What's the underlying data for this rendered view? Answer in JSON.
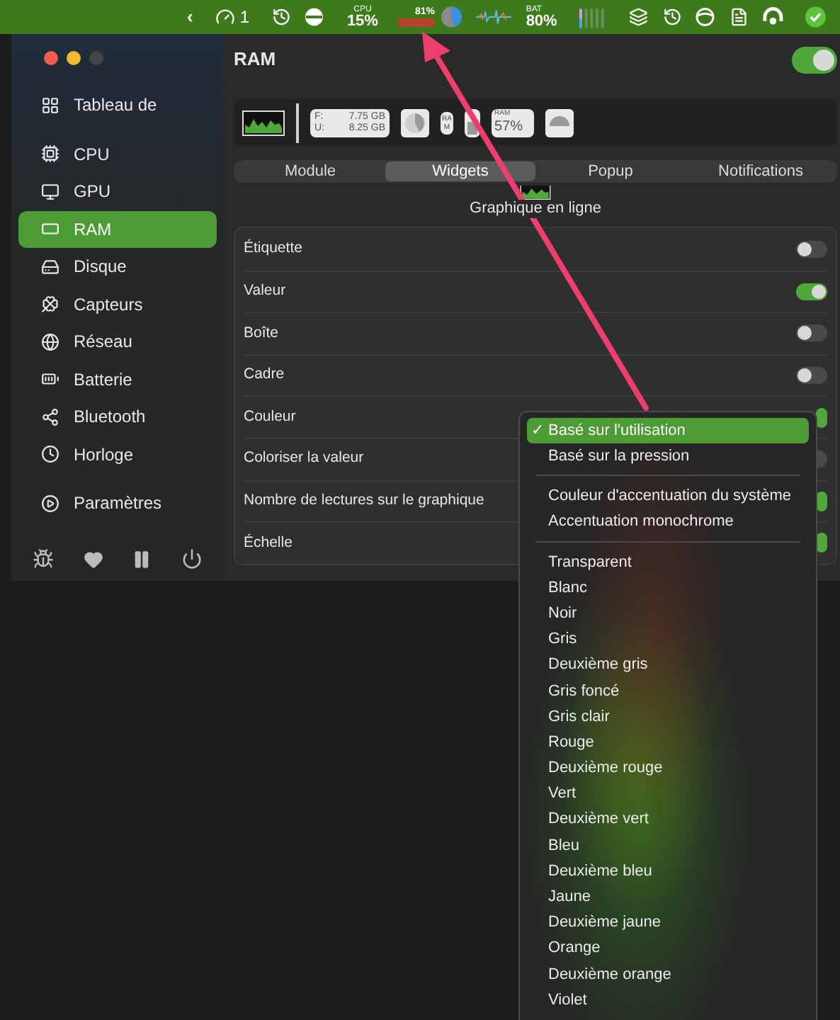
{
  "menu_bar": {
    "back": "‹",
    "count": "1",
    "cpu_label": "CPU",
    "cpu_value": "15%",
    "ram_value": "81%",
    "bat_label": "BAT",
    "bat_value": "80%"
  },
  "sidebar": {
    "items": [
      {
        "label": "Tableau de",
        "selected": false
      },
      {
        "label": "CPU",
        "selected": false
      },
      {
        "label": "GPU",
        "selected": false
      },
      {
        "label": "RAM",
        "selected": true
      },
      {
        "label": "Disque",
        "selected": false
      },
      {
        "label": "Capteurs",
        "selected": false
      },
      {
        "label": "Réseau",
        "selected": false
      },
      {
        "label": "Batterie",
        "selected": false
      },
      {
        "label": "Bluetooth",
        "selected": false
      },
      {
        "label": "Horloge",
        "selected": false
      },
      {
        "label": "Paramètres",
        "selected": false
      }
    ]
  },
  "header": {
    "title": "RAM",
    "enabled": true
  },
  "widgets": [
    {
      "kind": "line_chart"
    },
    {
      "kind": "divider"
    },
    {
      "kind": "memory",
      "free_label": "F:",
      "free": "7.75 GB",
      "used_label": "U:",
      "used": "8.25 GB"
    },
    {
      "kind": "pie"
    },
    {
      "kind": "vertical_label",
      "text": "RAM"
    },
    {
      "kind": "battery"
    },
    {
      "kind": "mini",
      "label": "RAM",
      "value": "57%"
    },
    {
      "kind": "gauge"
    }
  ],
  "tabs": [
    {
      "label": "Module",
      "selected": false
    },
    {
      "label": "Widgets",
      "selected": true
    },
    {
      "label": "Popup",
      "selected": false
    },
    {
      "label": "Notifications",
      "selected": false
    }
  ],
  "preview": {
    "label": "Graphique en ligne"
  },
  "settings": [
    {
      "label": "Étiquette",
      "kind": "toggle",
      "on": false
    },
    {
      "label": "Valeur",
      "kind": "toggle",
      "on": true
    },
    {
      "label": "Boîte",
      "kind": "toggle",
      "on": false
    },
    {
      "label": "Cadre",
      "kind": "toggle",
      "on": false
    },
    {
      "label": "Couleur",
      "kind": "select"
    },
    {
      "label": "Coloriser la valeur",
      "kind": "toggle",
      "on": false
    },
    {
      "label": "Nombre de lectures sur le graphique",
      "kind": "select"
    },
    {
      "label": "Échelle",
      "kind": "select"
    }
  ],
  "color_menu": {
    "mark": "✓",
    "groups": [
      [
        {
          "label": "Basé sur l'utilisation",
          "selected": true
        },
        {
          "label": "Basé sur la pression",
          "selected": false
        }
      ],
      [
        {
          "label": "Couleur d'accentuation du système",
          "selected": false
        },
        {
          "label": "Accentuation monochrome",
          "selected": false
        }
      ],
      [
        {
          "label": "Transparent",
          "selected": false
        },
        {
          "label": "Blanc",
          "selected": false
        },
        {
          "label": "Noir",
          "selected": false
        },
        {
          "label": "Gris",
          "selected": false
        },
        {
          "label": "Deuxième gris",
          "selected": false
        },
        {
          "label": "Gris foncé",
          "selected": false
        },
        {
          "label": "Gris clair",
          "selected": false
        },
        {
          "label": "Rouge",
          "selected": false
        },
        {
          "label": "Deuxième rouge",
          "selected": false
        },
        {
          "label": "Vert",
          "selected": false
        },
        {
          "label": "Deuxième vert",
          "selected": false
        },
        {
          "label": "Bleu",
          "selected": false
        },
        {
          "label": "Deuxième bleu",
          "selected": false
        },
        {
          "label": "Jaune",
          "selected": false
        },
        {
          "label": "Deuxième jaune",
          "selected": false
        },
        {
          "label": "Orange",
          "selected": false
        },
        {
          "label": "Deuxième orange",
          "selected": false
        },
        {
          "label": "Violet",
          "selected": false
        }
      ]
    ]
  }
}
